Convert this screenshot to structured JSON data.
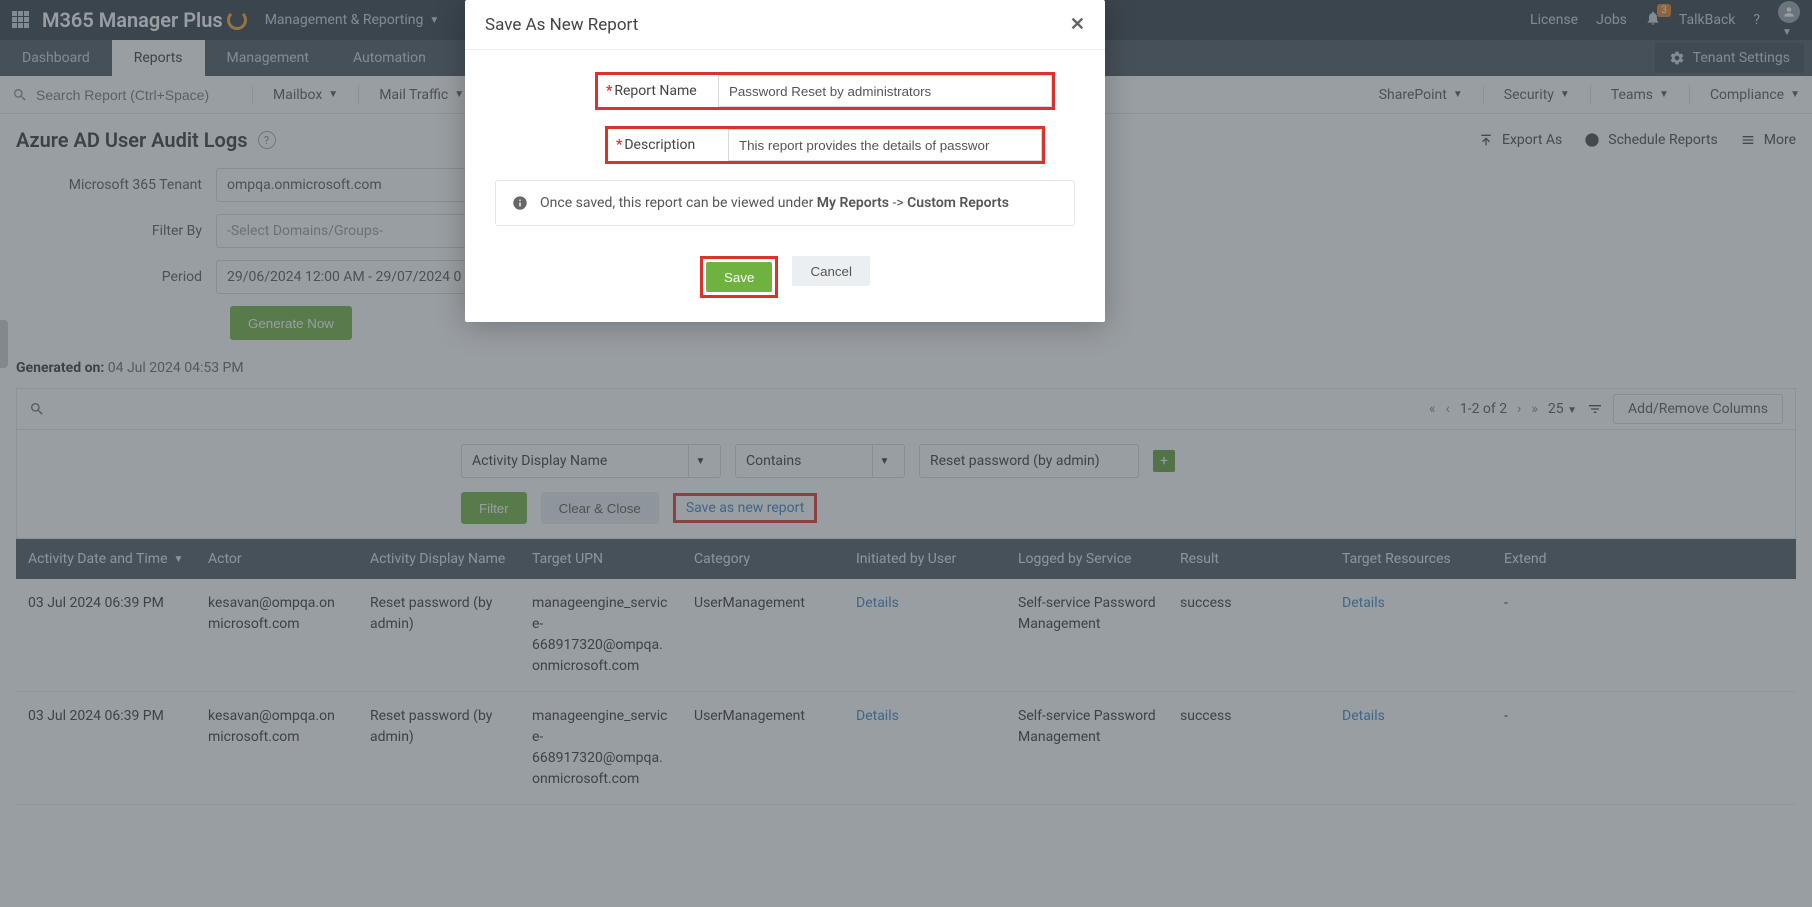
{
  "topbar": {
    "logo": "M365 Manager Plus",
    "dropdown": "Management & Reporting",
    "license": "License",
    "jobs": "Jobs",
    "talkback": "TalkBack",
    "bell_badge": "3"
  },
  "tabs": {
    "dashboard": "Dashboard",
    "reports": "Reports",
    "management": "Management",
    "automation": "Automation",
    "tenant_settings": "Tenant Settings"
  },
  "filterbar": {
    "search_placeholder": "Search Report (Ctrl+Space)",
    "mailbox": "Mailbox",
    "mailtraffic": "Mail Traffic",
    "sharepoint": "SharePoint",
    "security": "Security",
    "teams": "Teams",
    "compliance": "Compliance"
  },
  "page": {
    "title": "Azure AD User Audit Logs",
    "export_as": "Export As",
    "schedule": "Schedule Reports",
    "more": "More"
  },
  "form": {
    "tenant_label": "Microsoft 365 Tenant",
    "tenant_value": "ompqa.onmicrosoft.com",
    "filterby_label": "Filter By",
    "filterby_value": "-Select Domains/Groups-",
    "period_label": "Period",
    "period_value": "29/06/2024 12:00 AM - 29/07/2024 0",
    "generate": "Generate Now"
  },
  "generated": {
    "label": "Generated on:",
    "value": "04 Jul 2024 04:53 PM"
  },
  "toolbar": {
    "range": "1-2 of 2",
    "pagesize": "25",
    "cols": "Add/Remove Columns"
  },
  "query": {
    "field": "Activity Display Name",
    "op": "Contains",
    "value": "Reset password (by admin)",
    "filter": "Filter",
    "clear": "Clear & Close",
    "saveas": "Save as new report"
  },
  "columns": {
    "date": "Activity Date and Time",
    "actor": "Actor",
    "adn": "Activity Display Name",
    "upn": "Target UPN",
    "cat": "Category",
    "init": "Initiated by User",
    "log": "Logged by Service",
    "res": "Result",
    "targ": "Target Resources",
    "ext": "Extend"
  },
  "rows": [
    {
      "date": "03 Jul 2024 06:39 PM",
      "actor": "kesavan@ompqa.onmicrosoft.com",
      "adn": "Reset password (by admin)",
      "upn": "manageengine_service-668917320@ompqa.onmicrosoft.com",
      "cat": "UserManagement",
      "init": "Details",
      "log": "Self-service Password Management",
      "res": "success",
      "targ": "Details",
      "ext": "-"
    },
    {
      "date": "03 Jul 2024 06:39 PM",
      "actor": "kesavan@ompqa.onmicrosoft.com",
      "adn": "Reset password (by admin)",
      "upn": "manageengine_service-668917320@ompqa.onmicrosoft.com",
      "cat": "UserManagement",
      "init": "Details",
      "log": "Self-service Password Management",
      "res": "success",
      "targ": "Details",
      "ext": "-"
    }
  ],
  "modal": {
    "title": "Save As New Report",
    "name_label": "Report Name",
    "name_value": "Password Reset by administrators",
    "desc_label": "Description",
    "desc_value": "This report provides the details of passwor",
    "info_pre": "Once saved, this report can be viewed under ",
    "info_b1": "My Reports",
    "info_mid": " -> ",
    "info_b2": "Custom Reports",
    "save": "Save",
    "cancel": "Cancel"
  }
}
